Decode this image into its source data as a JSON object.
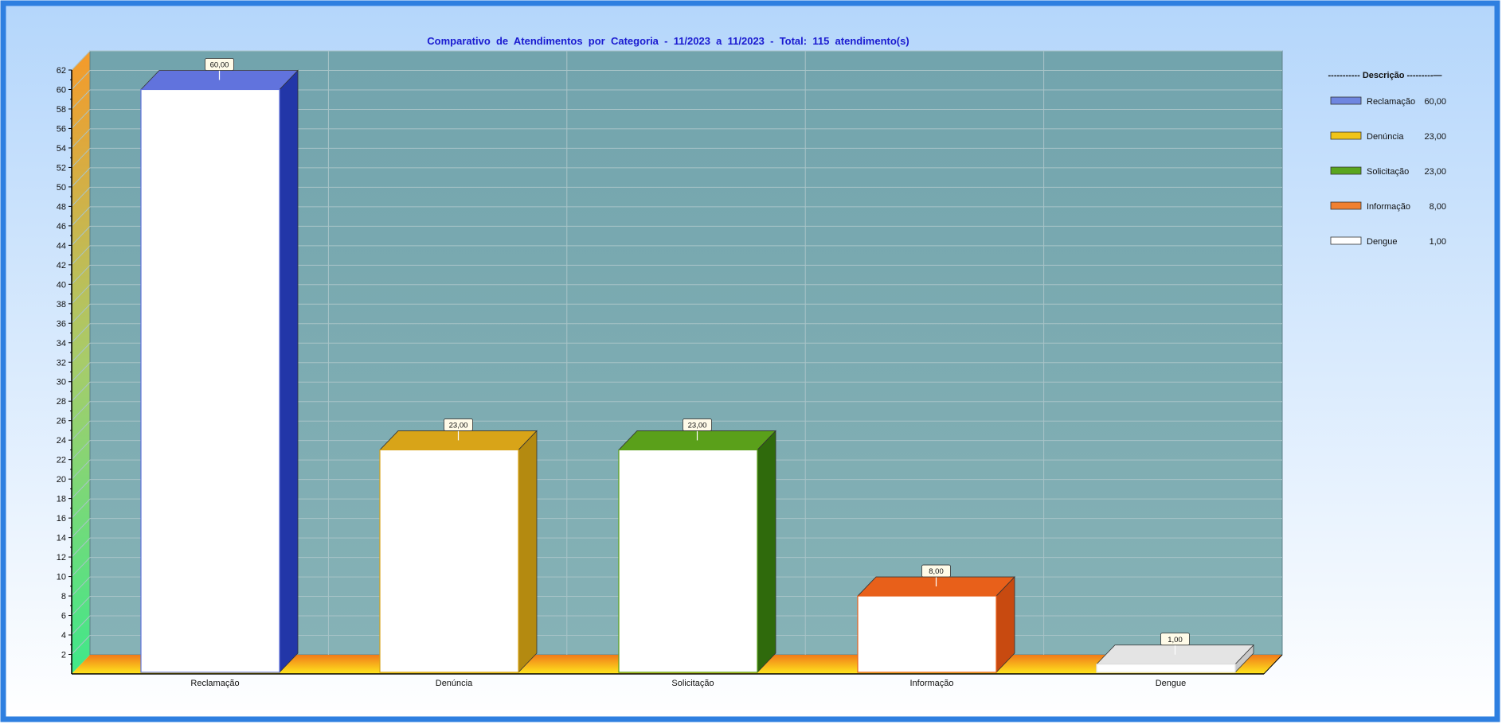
{
  "chart_data": {
    "type": "bar",
    "title": "Comparativo  de  Atendimentos  por  Categoria  -  11/2023  a  11/2023  -  Total:  115  atendimento(s)",
    "categories": [
      "Reclamação",
      "Denúncia",
      "Solicitação",
      "Informação",
      "Dengue"
    ],
    "values": [
      60,
      23,
      23,
      8,
      1
    ],
    "value_labels": [
      "60,00",
      "23,00",
      "23,00",
      "8,00",
      "1,00"
    ],
    "ylim": [
      0,
      62
    ],
    "yticks": [
      "2",
      "4",
      "6",
      "8",
      "10",
      "12",
      "14",
      "16",
      "18",
      "20",
      "22",
      "24",
      "26",
      "28",
      "30",
      "32",
      "34",
      "36",
      "38",
      "40",
      "42",
      "44",
      "46",
      "48",
      "50",
      "52",
      "54",
      "56",
      "58",
      "60",
      "62"
    ],
    "grid": true,
    "legend": {
      "placement": "right",
      "header": "----------- Descrição ---------—",
      "entries": [
        {
          "name": "Reclamação",
          "value": "60,00",
          "color": "#6f86e0"
        },
        {
          "name": "Denúncia",
          "value": "23,00",
          "color": "#f0c419"
        },
        {
          "name": "Solicitação",
          "value": "23,00",
          "color": "#5aa51e"
        },
        {
          "name": "Informação",
          "value": "8,00",
          "color": "#f08030"
        },
        {
          "name": "Dengue",
          "value": "1,00",
          "color": "#ffffff"
        }
      ]
    },
    "colors": {
      "frame": "#2e7fe0",
      "plot_background": "#7aa9b0",
      "floor": "#ffd21a",
      "bar_face": "#ffffff",
      "Reclamação_top": "#6173dd",
      "Reclamação_side": "#2236a8",
      "Denúncia_top": "#d8a418",
      "Denúncia_side": "#b48a10",
      "Solicitação_top": "#5aa01a",
      "Solicitação_side": "#2f6a0c",
      "Informação_top": "#e8601a",
      "Informação_side": "#c84a10",
      "Dengue_top": "#e4e4e4",
      "Dengue_side": "#c8c8c8"
    }
  }
}
